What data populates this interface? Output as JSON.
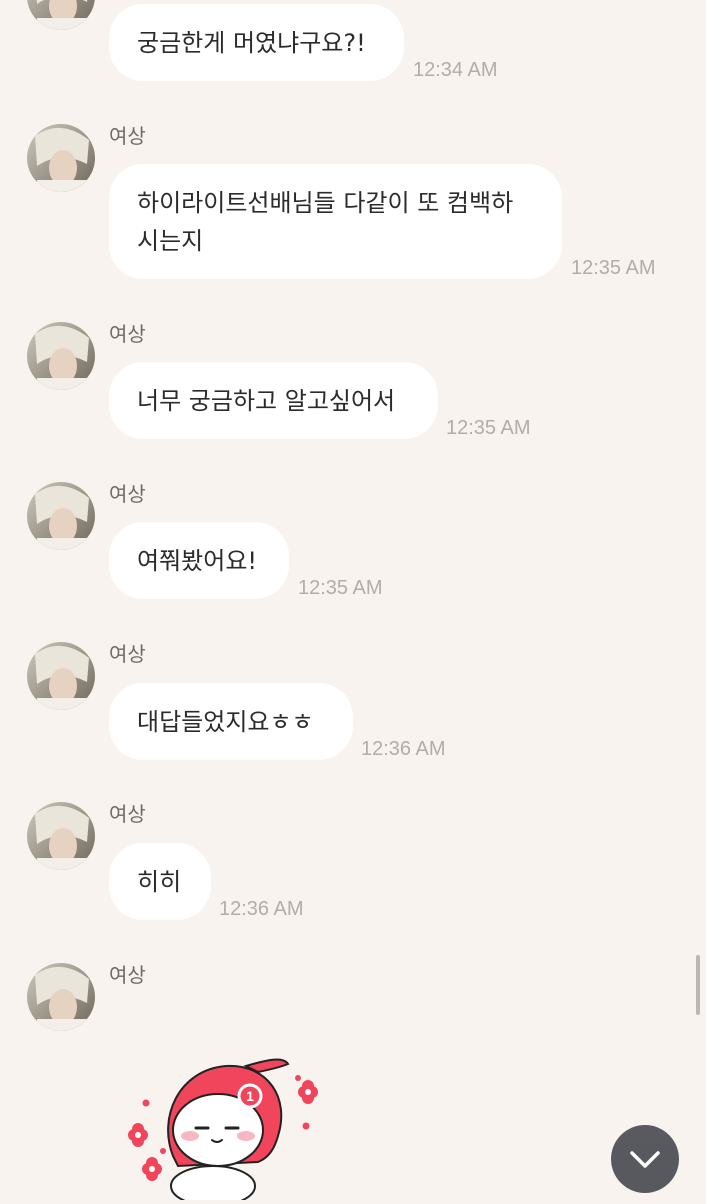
{
  "messages": [
    {
      "sender": "",
      "text": "궁금한게 머였냐구요?!",
      "time": "12:34 AM"
    },
    {
      "sender": "여상",
      "text": "하이라이트선배님들 다같이 또 컴백하시는지",
      "time": "12:35 AM"
    },
    {
      "sender": "여상",
      "text": "너무 궁금하고 알고싶어서",
      "time": "12:35 AM"
    },
    {
      "sender": "여상",
      "text": "여쭤봤어요!",
      "time": "12:35 AM"
    },
    {
      "sender": "여상",
      "text": "대답들었지요ㅎㅎ",
      "time": "12:36 AM"
    },
    {
      "sender": "여상",
      "text": "히히",
      "time": "12:36 AM"
    }
  ],
  "sticker_message": {
    "sender": "여상",
    "sticker_badge": "1",
    "sticker_icon": "red-hood-character-sticker"
  },
  "controls": {
    "scroll_down_icon": "chevron-down-icon"
  },
  "colors": {
    "background": "#f8f3ee",
    "bubble": "#ffffff",
    "sticker_red": "#f0455a",
    "scroll_button": "#4a4d52"
  }
}
